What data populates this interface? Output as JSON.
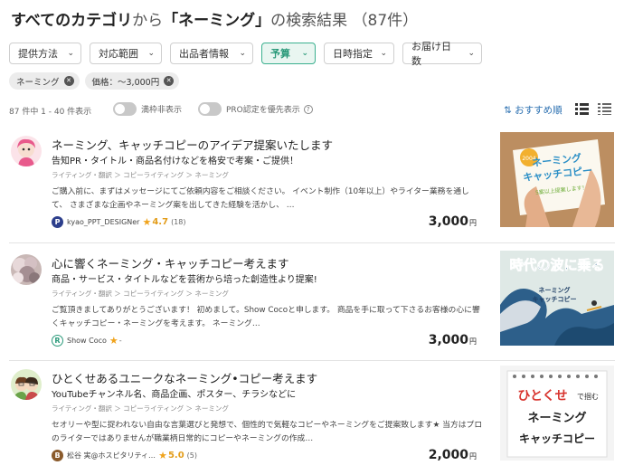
{
  "heading": {
    "category": "すべてのカテゴリ",
    "from": "から",
    "keyword": "「ネーミング」",
    "suffix": "の検索結果",
    "count": "（87件）"
  },
  "filters": [
    {
      "label": "提供方法",
      "active": false
    },
    {
      "label": "対応範囲",
      "active": false
    },
    {
      "label": "出品者情報",
      "active": false
    },
    {
      "label": "予算",
      "active": true
    },
    {
      "label": "日時指定",
      "active": false
    },
    {
      "label": "お届け日数",
      "active": false
    }
  ],
  "tags": [
    {
      "label": "ネーミング"
    },
    {
      "label": "価格：～3,000円"
    }
  ],
  "meta": {
    "count_text": "87 件中 1 - 40 件表示",
    "toggle_sold_out": "満枠非表示",
    "toggle_pro": "PRO認定を優先表示",
    "help": "?",
    "sort_label": "おすすめ順"
  },
  "items": [
    {
      "title": "ネーミング、キャッチコピーのアイデア提案いたします",
      "subtitle": "告知PR・タイトル・商品名付けなどを格安で考案・ご提供！",
      "crumb": "ライティング・翻訳 ＞ コピーライティング ＞ ネーミング",
      "desc": "ご購入前に、まずはメッセージにてご依頼内容をご相談ください。 イベント制作（10年以上）やライター業務を通して、 さまざまな企画やネーミング案を出してきた経験を活かし、 …",
      "badge": "P",
      "badge_color": "#2d3f8c",
      "seller": "kyao_PPT_DESIGNer",
      "star": "★",
      "rating": "4.7",
      "reviews": "(18)",
      "price": "3,000",
      "yen": "円",
      "thumb": {
        "line1": "ネーミング",
        "line2": "キャッチコピー",
        "line3": "5案以上提案します！",
        "seal": "2004"
      }
    },
    {
      "title": "心に響くネーミング・キャッチコピー考えます",
      "subtitle": "商品・サービス・タイトルなどを芸術から培った創造性より提案!",
      "crumb": "ライティング・翻訳 ＞ コピーライティング ＞ ネーミング",
      "desc": "ご覧頂きましてありがとうございます！ 初めまして。Show Cocoと申します。 商品を手に取って下さるお客様の心に響くキャッチコピー・ネーミングを考えます。 ネーミング…",
      "badge": "R",
      "badge_color": "#ffffff",
      "seller": "Show Coco",
      "star": "★",
      "rating": "",
      "reviews": "-",
      "price": "3,000",
      "yen": "円",
      "thumb": {
        "line1": "時代の波に乗る",
        "line2": "ネーミング",
        "line3": "キャッチコピー"
      }
    },
    {
      "title": "ひとくせあるユニークなネーミング•コピー考えます",
      "subtitle": "YouTubeチャンネル名、商品企画、ポスター、チラシなどに",
      "crumb": "ライティング・翻訳 ＞ コピーライティング ＞ ネーミング",
      "desc": "セオリーや型に捉われない自由な言葉選びと発想で、個性的で気軽なコピーやネーミングをご提案致します★ 当方はプロのライターではありませんが職業柄日常的にコピーやネーミングの作成…",
      "badge": "B",
      "badge_color": "#8a5a2b",
      "seller": "松谷 実@ホスピタリティ…",
      "star": "★",
      "rating": "5.0",
      "reviews": "(5)",
      "price": "2,000",
      "yen": "円",
      "thumb": {
        "line1a": "ひとくせ",
        "line1b": "で掴む",
        "line2": "ネーミング",
        "line3": "キャッチコピー"
      }
    }
  ],
  "colors": {
    "accent": "#3bb08f",
    "link": "#2a6fb0",
    "star": "#f0a31c"
  }
}
